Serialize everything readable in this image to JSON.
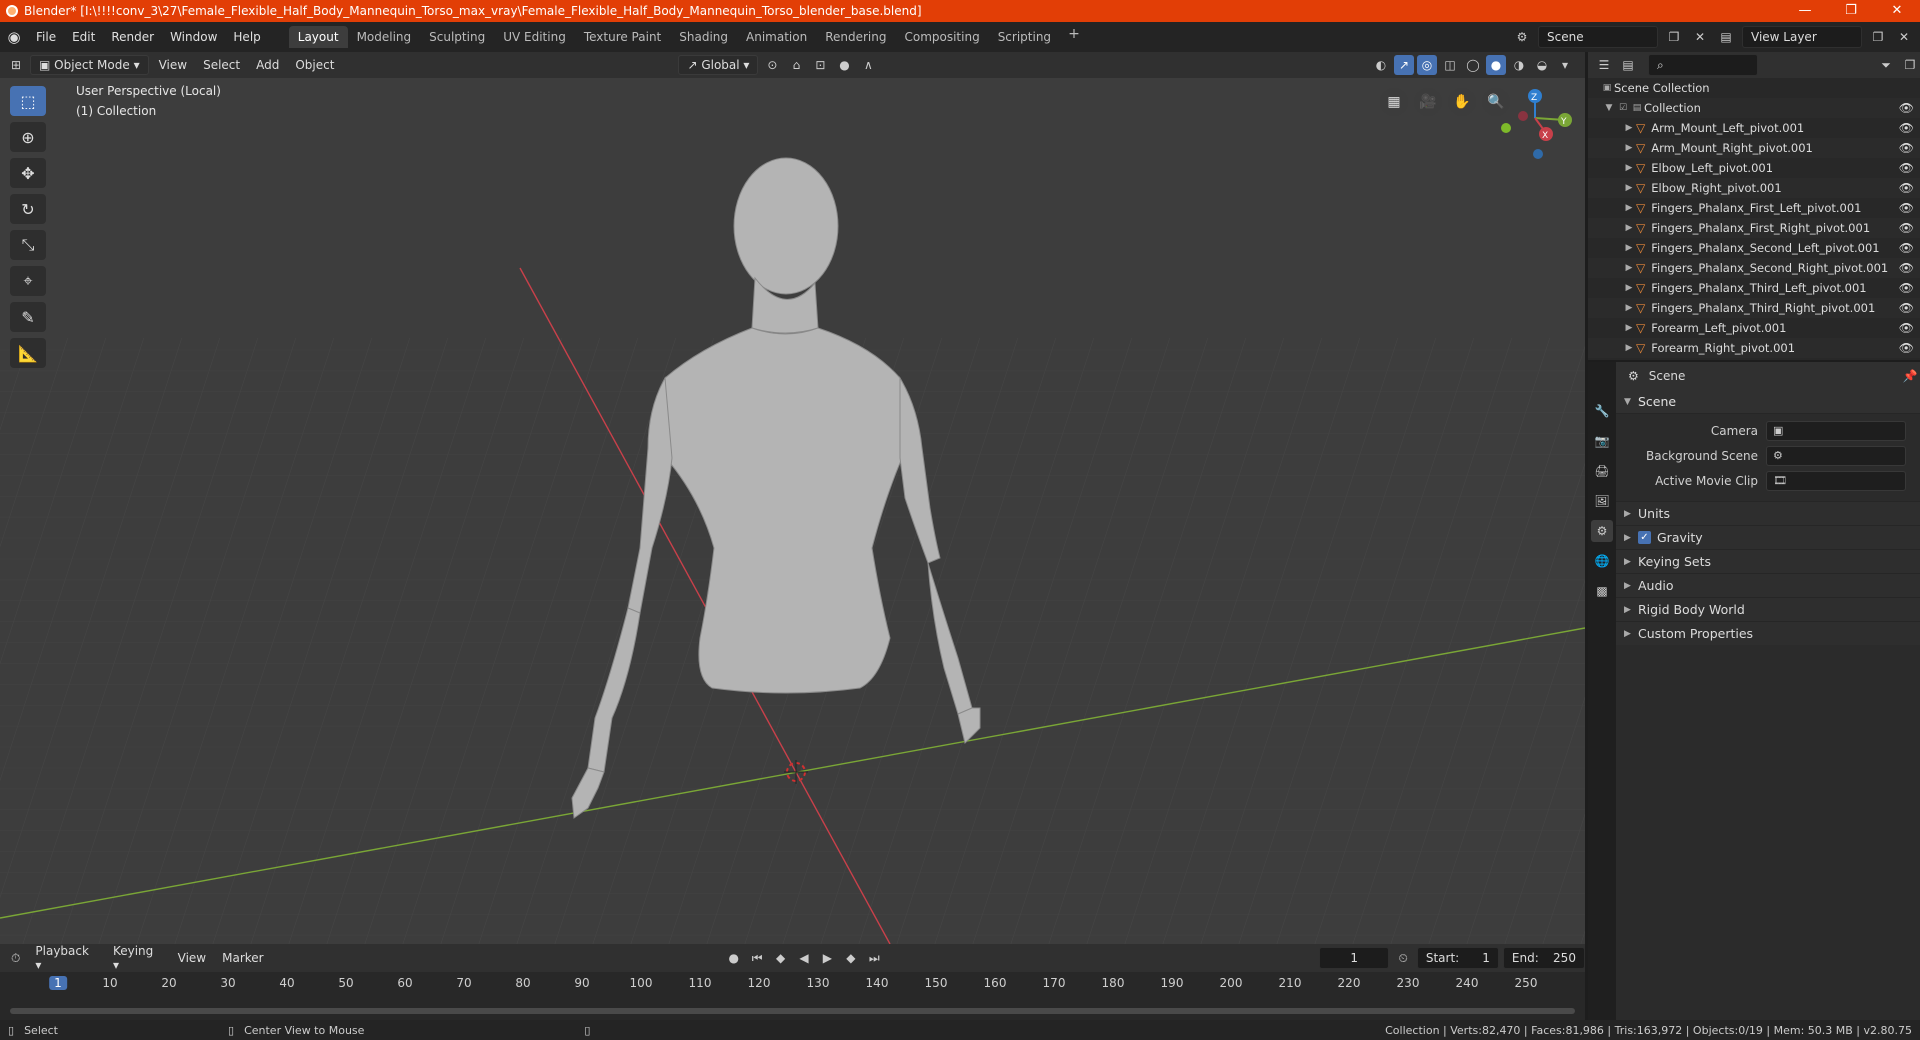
{
  "window": {
    "title": "Blender* [I:\\!!!!conv_3\\27\\Female_Flexible_Half_Body_Mannequin_Torso_max_vray\\Female_Flexible_Half_Body_Mannequin_Torso_blender_base.blend]",
    "controls": [
      "—",
      "❐",
      "✕"
    ]
  },
  "menu": [
    "File",
    "Edit",
    "Render",
    "Window",
    "Help"
  ],
  "workspaces": [
    "Layout",
    "Modeling",
    "Sculpting",
    "UV Editing",
    "Texture Paint",
    "Shading",
    "Animation",
    "Rendering",
    "Compositing",
    "Scripting"
  ],
  "active_workspace": "Layout",
  "top_right": {
    "scene": "Scene",
    "view_layer": "View Layer"
  },
  "viewport_header": {
    "mode": "Object Mode",
    "menus": [
      "View",
      "Select",
      "Add",
      "Object"
    ],
    "transform_orientation": "Global"
  },
  "viewport": {
    "perspective_label": "User Perspective (Local)",
    "collection_label": "(1) Collection",
    "gizmo_axes": {
      "z": "Z",
      "y": "Y",
      "x": "X"
    },
    "colors": {
      "x_axis": "#c8404a",
      "y_axis": "#7aa636",
      "z_axis": "#2f7fd0",
      "background": "#3d3d3d",
      "mesh": "#b4b4b4"
    }
  },
  "timeline": {
    "menus": [
      "Playback",
      "Keying",
      "View",
      "Marker"
    ],
    "current_frame": "1",
    "start_label": "Start:",
    "start": "1",
    "end_label": "End:",
    "end": "250",
    "ticks": [
      "1",
      "10",
      "20",
      "30",
      "40",
      "50",
      "60",
      "70",
      "80",
      "90",
      "100",
      "110",
      "120",
      "130",
      "140",
      "150",
      "160",
      "170",
      "180",
      "190",
      "200",
      "210",
      "220",
      "230",
      "240",
      "250"
    ]
  },
  "statusbar": {
    "left": [
      "Select",
      "Center View to Mouse"
    ],
    "right": "Collection | Verts:82,470 | Faces:81,986 | Tris:163,972 | Objects:0/19 | Mem: 50.3 MB | v2.80.75"
  },
  "outliner": {
    "root": "Scene Collection",
    "collection": "Collection",
    "items": [
      "Arm_Mount_Left_pivot.001",
      "Arm_Mount_Right_pivot.001",
      "Elbow_Left_pivot.001",
      "Elbow_Right_pivot.001",
      "Fingers_Phalanx_First_Left_pivot.001",
      "Fingers_Phalanx_First_Right_pivot.001",
      "Fingers_Phalanx_Second_Left_pivot.001",
      "Fingers_Phalanx_Second_Right_pivot.001",
      "Fingers_Phalanx_Third_Left_pivot.001",
      "Fingers_Phalanx_Third_Right_pivot.001",
      "Forearm_Left_pivot.001",
      "Forearm_Right_pivot.001"
    ]
  },
  "properties": {
    "context": "Scene",
    "scene_panel": "Scene",
    "fields": [
      {
        "label": "Camera"
      },
      {
        "label": "Background Scene"
      },
      {
        "label": "Active Movie Clip"
      }
    ],
    "subpanels": [
      "Units",
      "Gravity",
      "Keying Sets",
      "Audio",
      "Rigid Body World",
      "Custom Properties"
    ]
  }
}
